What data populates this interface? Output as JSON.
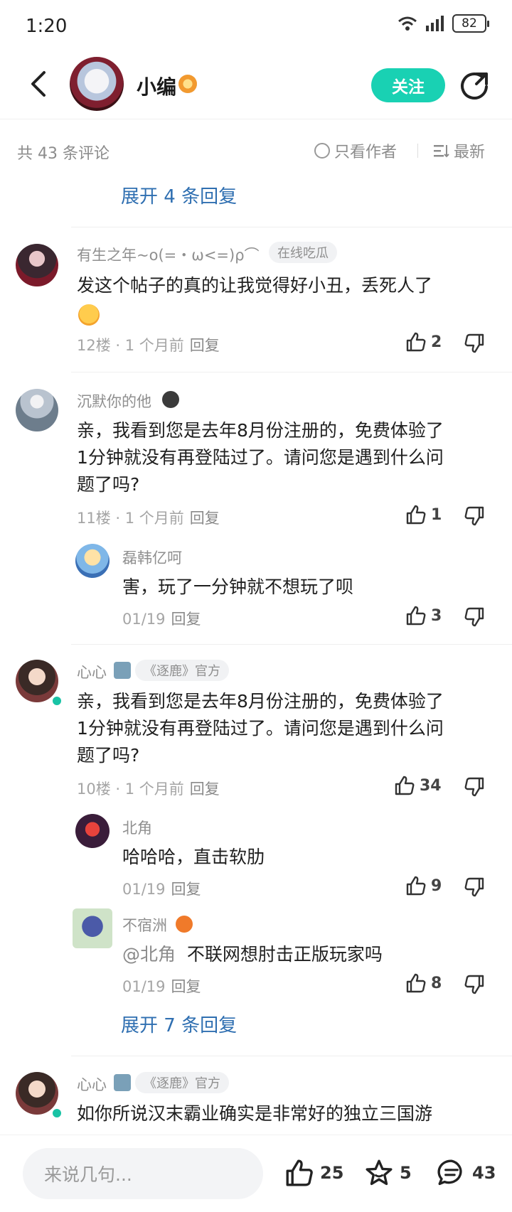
{
  "status_bar": {
    "time": "1:20",
    "battery": "82"
  },
  "header": {
    "name": "小编",
    "follow_label": "关注"
  },
  "filter": {
    "count_label": "共 43 条评论",
    "author_only": "只看作者",
    "sort": "最新"
  },
  "top_expand": "展开 4 条回复",
  "comments": [
    {
      "user": "有生之年~o(=・ω<=)ρ⌒",
      "tag": "在线吃瓜",
      "text_line1": "发这个帖子的真的让我觉得好小丑，丢死人了",
      "meta": "12楼 · 1 个月前",
      "reply": "回复",
      "likes": "2"
    },
    {
      "user": "沉默你的他",
      "text_line1": "亲，我看到您是去年8月份注册的，免费体验了",
      "text_line2": "1分钟就没有再登陆过了。请问您是遇到什么问",
      "text_line3": "题了吗?",
      "meta": "11楼 · 1 个月前",
      "reply": "回复",
      "likes": "1",
      "replies": [
        {
          "user": "磊韩亿呵",
          "text": "害，玩了一分钟就不想玩了呗",
          "meta": "01/19",
          "reply": "回复",
          "likes": "3"
        }
      ]
    },
    {
      "user": "心心",
      "tag": "《逐鹿》官方",
      "text_line1": "亲，我看到您是去年8月份注册的，免费体验了",
      "text_line2": "1分钟就没有再登陆过了。请问您是遇到什么问",
      "text_line3": "题了吗?",
      "meta": "10楼 · 1 个月前",
      "reply": "回复",
      "likes": "34",
      "replies": [
        {
          "user": "北角",
          "text": "哈哈哈，直击软肋",
          "meta": "01/19",
          "reply": "回复",
          "likes": "9"
        },
        {
          "user": "不宿洲",
          "mention": "@北角",
          "text": "不联网想肘击正版玩家吗",
          "meta": "01/19",
          "reply": "回复",
          "likes": "8"
        }
      ],
      "expand": "展开 7 条回复"
    },
    {
      "user": "心心",
      "tag": "《逐鹿》官方",
      "text_line1": "如你所说汉末霸业确实是非常好的独立三国游"
    }
  ],
  "bottom_bar": {
    "placeholder": "来说几句...",
    "likes": "25",
    "stars": "5",
    "comments": "43"
  },
  "colors": {
    "accent": "#19d1b3",
    "link": "#2f6fb1",
    "verified": "#19c3a5"
  }
}
